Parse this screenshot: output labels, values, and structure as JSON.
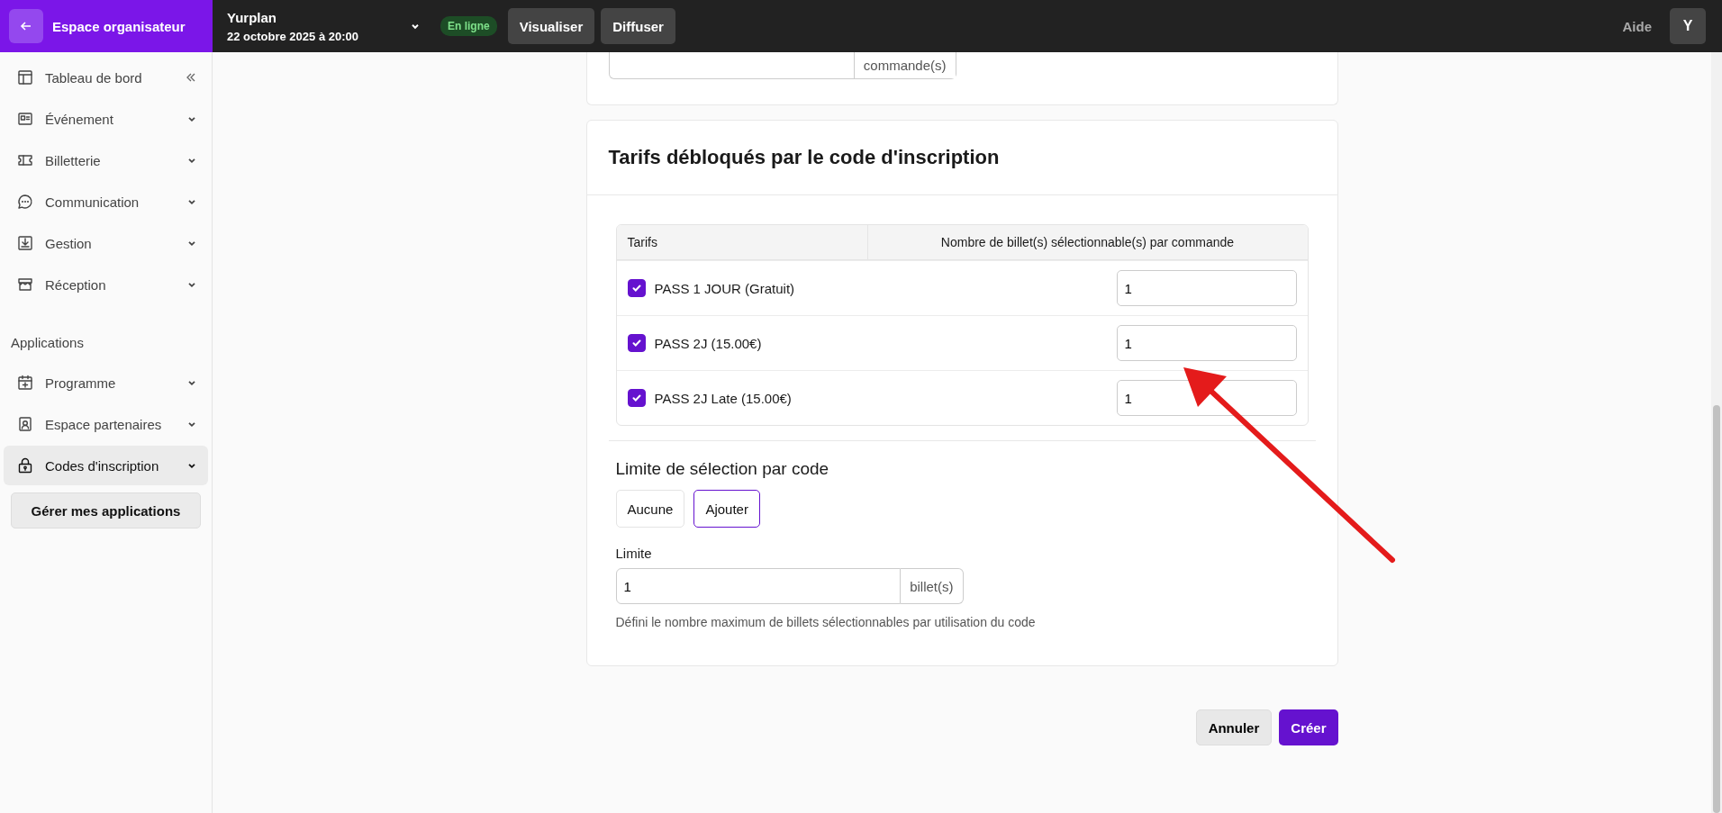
{
  "topbar": {
    "back_label": "Espace organisateur",
    "event_name": "Yurplan",
    "event_date": "22 octobre 2025 à 20:00",
    "status": "En ligne",
    "buttons": [
      "Visualiser",
      "Diffuser"
    ],
    "help": "Aide",
    "avatar": "Y"
  },
  "sidebar": {
    "items": [
      {
        "label": "Tableau de bord",
        "selected": false
      },
      {
        "label": "Événement",
        "selected": false
      },
      {
        "label": "Billetterie",
        "selected": false
      },
      {
        "label": "Communication",
        "selected": false
      },
      {
        "label": "Gestion",
        "selected": false
      },
      {
        "label": "Réception",
        "selected": false
      }
    ],
    "section_title": "Applications",
    "apps": [
      {
        "label": "Programme",
        "selected": false
      },
      {
        "label": "Espace partenaires",
        "selected": false
      },
      {
        "label": "Codes d'inscription",
        "selected": true
      }
    ],
    "manage_button": "Gérer mes applications"
  },
  "previous_card": {
    "suffix": "commande(s)"
  },
  "tarifs_card": {
    "title": "Tarifs débloqués par le code d'inscription",
    "columns": [
      "Tarifs",
      "Nombre de billet(s) sélectionnable(s) par commande"
    ],
    "rows": [
      {
        "label": "PASS 1 JOUR (Gratuit)",
        "checked": true,
        "value": "1"
      },
      {
        "label": "PASS 2J (15.00€)",
        "checked": true,
        "value": "1"
      },
      {
        "label": "PASS 2J Late (15.00€)",
        "checked": true,
        "value": "1"
      }
    ],
    "limit_title": "Limite de sélection par code",
    "limit_options": [
      {
        "label": "Aucune",
        "selected": false
      },
      {
        "label": "Ajouter",
        "selected": true
      }
    ],
    "limit_label": "Limite",
    "limit_value": "1",
    "limit_suffix": "billet(s)",
    "limit_help": "Défini le nombre maximum de billets sélectionnables par utilisation du code"
  },
  "actions": {
    "cancel": "Annuler",
    "submit": "Créer"
  }
}
